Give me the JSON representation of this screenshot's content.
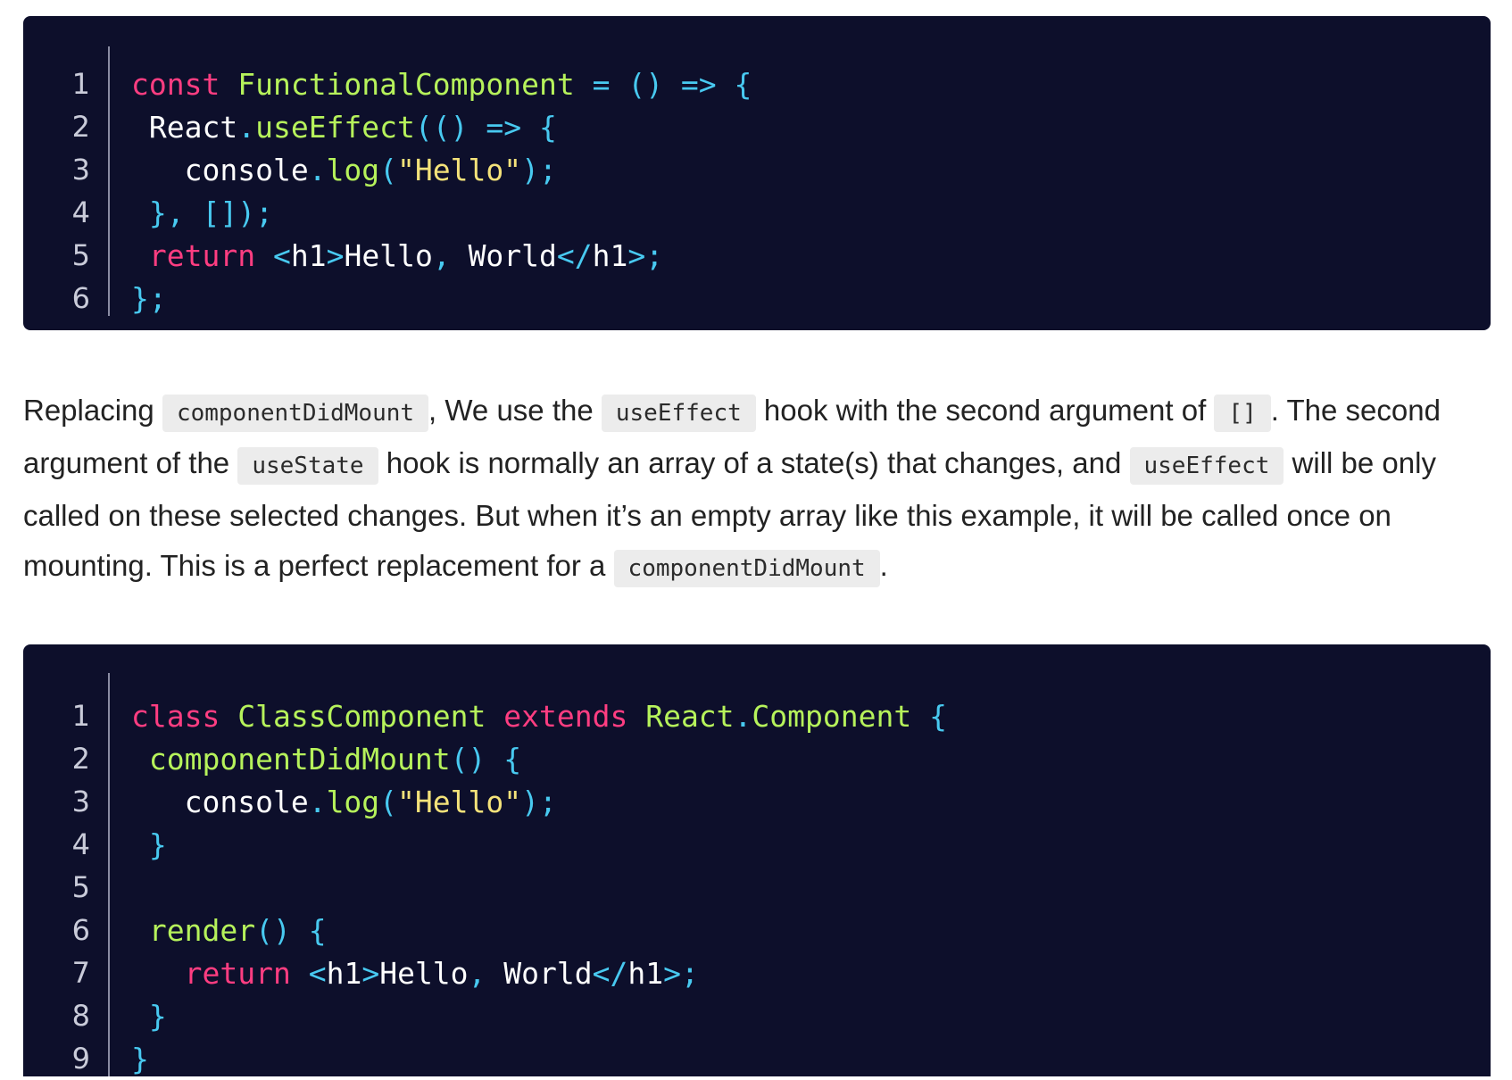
{
  "code_block_1": {
    "lines": [
      {
        "number": "1",
        "tokens": [
          {
            "t": "const",
            "c": "kw"
          },
          {
            "t": " ",
            "c": "tx"
          },
          {
            "t": "FunctionalComponent",
            "c": "fn"
          },
          {
            "t": " = () => {",
            "c": "pn"
          }
        ]
      },
      {
        "number": "2",
        "tokens": [
          {
            "t": " ",
            "c": "tx"
          },
          {
            "t": "React",
            "c": "tx"
          },
          {
            "t": ".",
            "c": "pn"
          },
          {
            "t": "useEffect",
            "c": "fn"
          },
          {
            "t": "(() => {",
            "c": "pn"
          }
        ]
      },
      {
        "number": "3",
        "tokens": [
          {
            "t": "   ",
            "c": "tx"
          },
          {
            "t": "console",
            "c": "tx"
          },
          {
            "t": ".",
            "c": "pn"
          },
          {
            "t": "log",
            "c": "fn"
          },
          {
            "t": "(",
            "c": "pn"
          },
          {
            "t": "\"Hello\"",
            "c": "st"
          },
          {
            "t": ");",
            "c": "pn"
          }
        ]
      },
      {
        "number": "4",
        "tokens": [
          {
            "t": " ",
            "c": "tx"
          },
          {
            "t": "}, []);",
            "c": "pn"
          }
        ]
      },
      {
        "number": "5",
        "tokens": [
          {
            "t": " ",
            "c": "tx"
          },
          {
            "t": "return",
            "c": "kw"
          },
          {
            "t": " ",
            "c": "tx"
          },
          {
            "t": "<",
            "c": "pn"
          },
          {
            "t": "h1",
            "c": "tx"
          },
          {
            "t": ">",
            "c": "pn"
          },
          {
            "t": "Hello",
            "c": "tx"
          },
          {
            "t": ", ",
            "c": "pn"
          },
          {
            "t": "World",
            "c": "tx"
          },
          {
            "t": "</",
            "c": "pn"
          },
          {
            "t": "h1",
            "c": "tx"
          },
          {
            "t": ">;",
            "c": "pn"
          }
        ]
      },
      {
        "number": "6",
        "tokens": [
          {
            "t": "};",
            "c": "pn"
          }
        ]
      }
    ]
  },
  "prose": {
    "segments": [
      {
        "type": "text",
        "value": "Replacing "
      },
      {
        "type": "code",
        "value": "componentDidMount"
      },
      {
        "type": "text",
        "value": ", We use the "
      },
      {
        "type": "code",
        "value": "useEffect"
      },
      {
        "type": "text",
        "value": " hook with the second argument of "
      },
      {
        "type": "code",
        "value": "[]"
      },
      {
        "type": "text",
        "value": ". The second argument of the "
      },
      {
        "type": "code",
        "value": "useState"
      },
      {
        "type": "text",
        "value": " hook is normally an array of a state(s) that changes, and "
      },
      {
        "type": "code",
        "value": "useEffect"
      },
      {
        "type": "text",
        "value": " will be only called on these selected changes. But when it’s an empty array like this example, it will be called once on mounting. This is a perfect replacement for a "
      },
      {
        "type": "code",
        "value": "componentDidMount"
      },
      {
        "type": "text",
        "value": "."
      }
    ]
  },
  "code_block_2": {
    "lines": [
      {
        "number": "1",
        "tokens": [
          {
            "t": "class",
            "c": "kw"
          },
          {
            "t": " ",
            "c": "tx"
          },
          {
            "t": "ClassComponent",
            "c": "fn"
          },
          {
            "t": " ",
            "c": "tx"
          },
          {
            "t": "extends",
            "c": "kw"
          },
          {
            "t": " ",
            "c": "tx"
          },
          {
            "t": "React",
            "c": "fn"
          },
          {
            "t": ".",
            "c": "pn"
          },
          {
            "t": "Component",
            "c": "fn"
          },
          {
            "t": " {",
            "c": "pn"
          }
        ]
      },
      {
        "number": "2",
        "tokens": [
          {
            "t": " ",
            "c": "tx"
          },
          {
            "t": "componentDidMount",
            "c": "fn"
          },
          {
            "t": "() {",
            "c": "pn"
          }
        ]
      },
      {
        "number": "3",
        "tokens": [
          {
            "t": "   ",
            "c": "tx"
          },
          {
            "t": "console",
            "c": "tx"
          },
          {
            "t": ".",
            "c": "pn"
          },
          {
            "t": "log",
            "c": "fn"
          },
          {
            "t": "(",
            "c": "pn"
          },
          {
            "t": "\"Hello\"",
            "c": "st"
          },
          {
            "t": ");",
            "c": "pn"
          }
        ]
      },
      {
        "number": "4",
        "tokens": [
          {
            "t": " ",
            "c": "tx"
          },
          {
            "t": "}",
            "c": "pn"
          }
        ]
      },
      {
        "number": "5",
        "tokens": []
      },
      {
        "number": "6",
        "tokens": [
          {
            "t": " ",
            "c": "tx"
          },
          {
            "t": "render",
            "c": "fn"
          },
          {
            "t": "() {",
            "c": "pn"
          }
        ]
      },
      {
        "number": "7",
        "tokens": [
          {
            "t": "   ",
            "c": "tx"
          },
          {
            "t": "return",
            "c": "kw"
          },
          {
            "t": " ",
            "c": "tx"
          },
          {
            "t": "<",
            "c": "pn"
          },
          {
            "t": "h1",
            "c": "tx"
          },
          {
            "t": ">",
            "c": "pn"
          },
          {
            "t": "Hello",
            "c": "tx"
          },
          {
            "t": ", ",
            "c": "pn"
          },
          {
            "t": "World",
            "c": "tx"
          },
          {
            "t": "</",
            "c": "pn"
          },
          {
            "t": "h1",
            "c": "tx"
          },
          {
            "t": ">;",
            "c": "pn"
          }
        ]
      },
      {
        "number": "8",
        "tokens": [
          {
            "t": " ",
            "c": "tx"
          },
          {
            "t": "}",
            "c": "pn"
          }
        ]
      },
      {
        "number": "9",
        "tokens": [
          {
            "t": "}",
            "c": "pn"
          }
        ]
      }
    ]
  },
  "colors": {
    "code_background": "#0d0f2b",
    "keyword": "#ff3d81",
    "function": "#b6f25b",
    "punctuation": "#48c9f0",
    "string": "#f4e27a",
    "inline_code_background": "#ececec"
  }
}
